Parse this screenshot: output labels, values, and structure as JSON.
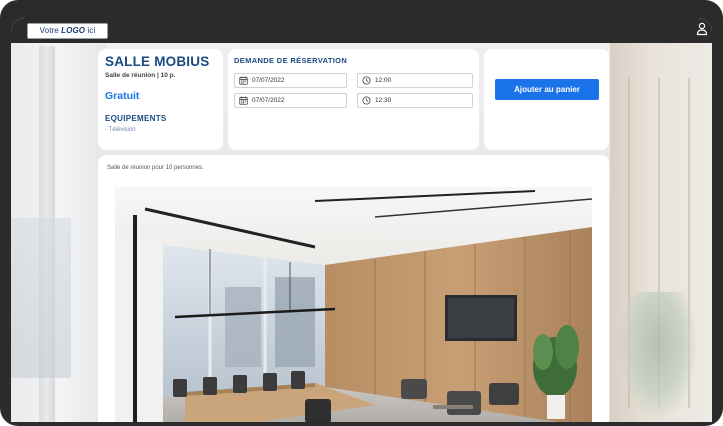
{
  "header": {
    "logo_prefix": "Votre ",
    "logo_bold": "LOGO",
    "logo_suffix": " ici"
  },
  "room": {
    "title": "SALLE MOBIUS",
    "subtitle": "Salle de réunion | 10 p.",
    "price": "Gratuit",
    "equipment_title": "EQUIPEMENTS",
    "equipment": [
      "- Télévision"
    ]
  },
  "reservation": {
    "title": "DEMANDE DE RÉSERVATION",
    "start_date": "07/07/2022",
    "start_time": "12:00",
    "end_date": "07/07/2022",
    "end_time": "12:30"
  },
  "cart": {
    "button_label": "Ajouter au panier"
  },
  "description": {
    "text": "Salle de réunion pour 10 personnes."
  },
  "colors": {
    "accent": "#1a73e8",
    "title": "#1a4a82",
    "frame": "#2b2b2b"
  },
  "icons": {
    "user": "user-icon",
    "calendar": "calendar-icon",
    "clock": "clock-icon"
  }
}
